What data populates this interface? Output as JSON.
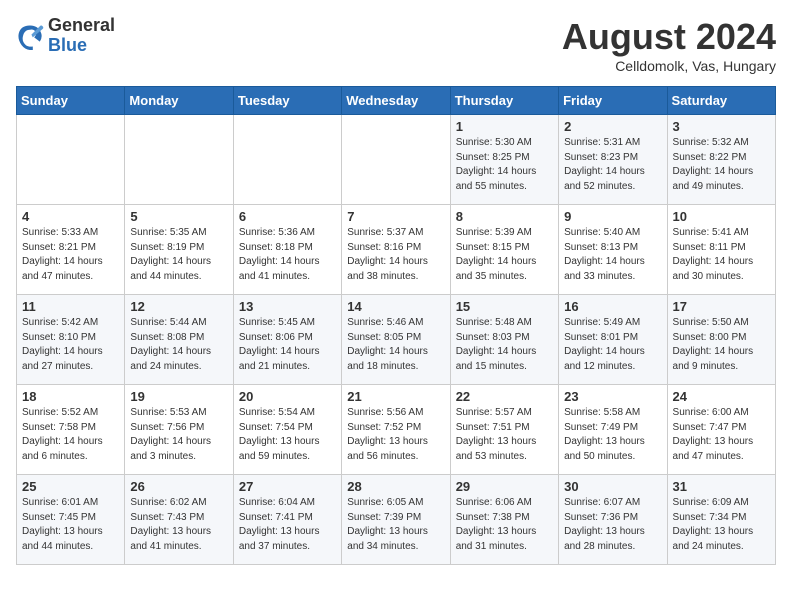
{
  "header": {
    "logo_general": "General",
    "logo_blue": "Blue",
    "title": "August 2024",
    "subtitle": "Celldomolk, Vas, Hungary"
  },
  "weekdays": [
    "Sunday",
    "Monday",
    "Tuesday",
    "Wednesday",
    "Thursday",
    "Friday",
    "Saturday"
  ],
  "weeks": [
    [
      {
        "day": "",
        "info": ""
      },
      {
        "day": "",
        "info": ""
      },
      {
        "day": "",
        "info": ""
      },
      {
        "day": "",
        "info": ""
      },
      {
        "day": "1",
        "info": "Sunrise: 5:30 AM\nSunset: 8:25 PM\nDaylight: 14 hours\nand 55 minutes."
      },
      {
        "day": "2",
        "info": "Sunrise: 5:31 AM\nSunset: 8:23 PM\nDaylight: 14 hours\nand 52 minutes."
      },
      {
        "day": "3",
        "info": "Sunrise: 5:32 AM\nSunset: 8:22 PM\nDaylight: 14 hours\nand 49 minutes."
      }
    ],
    [
      {
        "day": "4",
        "info": "Sunrise: 5:33 AM\nSunset: 8:21 PM\nDaylight: 14 hours\nand 47 minutes."
      },
      {
        "day": "5",
        "info": "Sunrise: 5:35 AM\nSunset: 8:19 PM\nDaylight: 14 hours\nand 44 minutes."
      },
      {
        "day": "6",
        "info": "Sunrise: 5:36 AM\nSunset: 8:18 PM\nDaylight: 14 hours\nand 41 minutes."
      },
      {
        "day": "7",
        "info": "Sunrise: 5:37 AM\nSunset: 8:16 PM\nDaylight: 14 hours\nand 38 minutes."
      },
      {
        "day": "8",
        "info": "Sunrise: 5:39 AM\nSunset: 8:15 PM\nDaylight: 14 hours\nand 35 minutes."
      },
      {
        "day": "9",
        "info": "Sunrise: 5:40 AM\nSunset: 8:13 PM\nDaylight: 14 hours\nand 33 minutes."
      },
      {
        "day": "10",
        "info": "Sunrise: 5:41 AM\nSunset: 8:11 PM\nDaylight: 14 hours\nand 30 minutes."
      }
    ],
    [
      {
        "day": "11",
        "info": "Sunrise: 5:42 AM\nSunset: 8:10 PM\nDaylight: 14 hours\nand 27 minutes."
      },
      {
        "day": "12",
        "info": "Sunrise: 5:44 AM\nSunset: 8:08 PM\nDaylight: 14 hours\nand 24 minutes."
      },
      {
        "day": "13",
        "info": "Sunrise: 5:45 AM\nSunset: 8:06 PM\nDaylight: 14 hours\nand 21 minutes."
      },
      {
        "day": "14",
        "info": "Sunrise: 5:46 AM\nSunset: 8:05 PM\nDaylight: 14 hours\nand 18 minutes."
      },
      {
        "day": "15",
        "info": "Sunrise: 5:48 AM\nSunset: 8:03 PM\nDaylight: 14 hours\nand 15 minutes."
      },
      {
        "day": "16",
        "info": "Sunrise: 5:49 AM\nSunset: 8:01 PM\nDaylight: 14 hours\nand 12 minutes."
      },
      {
        "day": "17",
        "info": "Sunrise: 5:50 AM\nSunset: 8:00 PM\nDaylight: 14 hours\nand 9 minutes."
      }
    ],
    [
      {
        "day": "18",
        "info": "Sunrise: 5:52 AM\nSunset: 7:58 PM\nDaylight: 14 hours\nand 6 minutes."
      },
      {
        "day": "19",
        "info": "Sunrise: 5:53 AM\nSunset: 7:56 PM\nDaylight: 14 hours\nand 3 minutes."
      },
      {
        "day": "20",
        "info": "Sunrise: 5:54 AM\nSunset: 7:54 PM\nDaylight: 13 hours\nand 59 minutes."
      },
      {
        "day": "21",
        "info": "Sunrise: 5:56 AM\nSunset: 7:52 PM\nDaylight: 13 hours\nand 56 minutes."
      },
      {
        "day": "22",
        "info": "Sunrise: 5:57 AM\nSunset: 7:51 PM\nDaylight: 13 hours\nand 53 minutes."
      },
      {
        "day": "23",
        "info": "Sunrise: 5:58 AM\nSunset: 7:49 PM\nDaylight: 13 hours\nand 50 minutes."
      },
      {
        "day": "24",
        "info": "Sunrise: 6:00 AM\nSunset: 7:47 PM\nDaylight: 13 hours\nand 47 minutes."
      }
    ],
    [
      {
        "day": "25",
        "info": "Sunrise: 6:01 AM\nSunset: 7:45 PM\nDaylight: 13 hours\nand 44 minutes."
      },
      {
        "day": "26",
        "info": "Sunrise: 6:02 AM\nSunset: 7:43 PM\nDaylight: 13 hours\nand 41 minutes."
      },
      {
        "day": "27",
        "info": "Sunrise: 6:04 AM\nSunset: 7:41 PM\nDaylight: 13 hours\nand 37 minutes."
      },
      {
        "day": "28",
        "info": "Sunrise: 6:05 AM\nSunset: 7:39 PM\nDaylight: 13 hours\nand 34 minutes."
      },
      {
        "day": "29",
        "info": "Sunrise: 6:06 AM\nSunset: 7:38 PM\nDaylight: 13 hours\nand 31 minutes."
      },
      {
        "day": "30",
        "info": "Sunrise: 6:07 AM\nSunset: 7:36 PM\nDaylight: 13 hours\nand 28 minutes."
      },
      {
        "day": "31",
        "info": "Sunrise: 6:09 AM\nSunset: 7:34 PM\nDaylight: 13 hours\nand 24 minutes."
      }
    ]
  ]
}
